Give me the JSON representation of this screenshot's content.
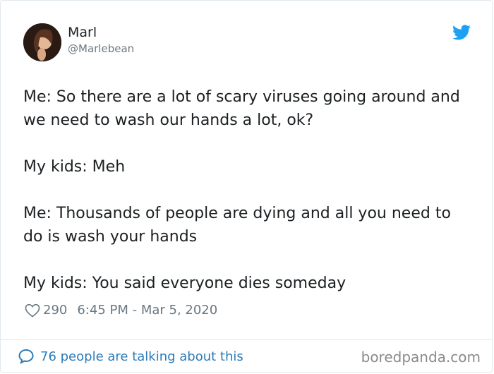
{
  "author": {
    "name": "Marl",
    "handle": "@Marlebean"
  },
  "tweet": {
    "lines": [
      "Me: So there are a lot of scary viruses going around and we need to wash our hands a lot, ok?",
      "My kids: Meh",
      "Me: Thousands of people are dying and all you need to do is wash your hands",
      "My kids: You said everyone dies someday"
    ]
  },
  "meta": {
    "likes": "290",
    "timestamp": "6:45 PM - Mar 5, 2020"
  },
  "footer": {
    "talking": "76 people are talking about this",
    "watermark": "boredpanda.com"
  },
  "icons": {
    "bird": "twitter-bird-icon",
    "heart": "heart-outline-icon",
    "comment": "speech-bubble-icon"
  },
  "colors": {
    "twitter_blue": "#1da1f2",
    "link_blue": "#2b7bb9",
    "muted": "#697882"
  }
}
